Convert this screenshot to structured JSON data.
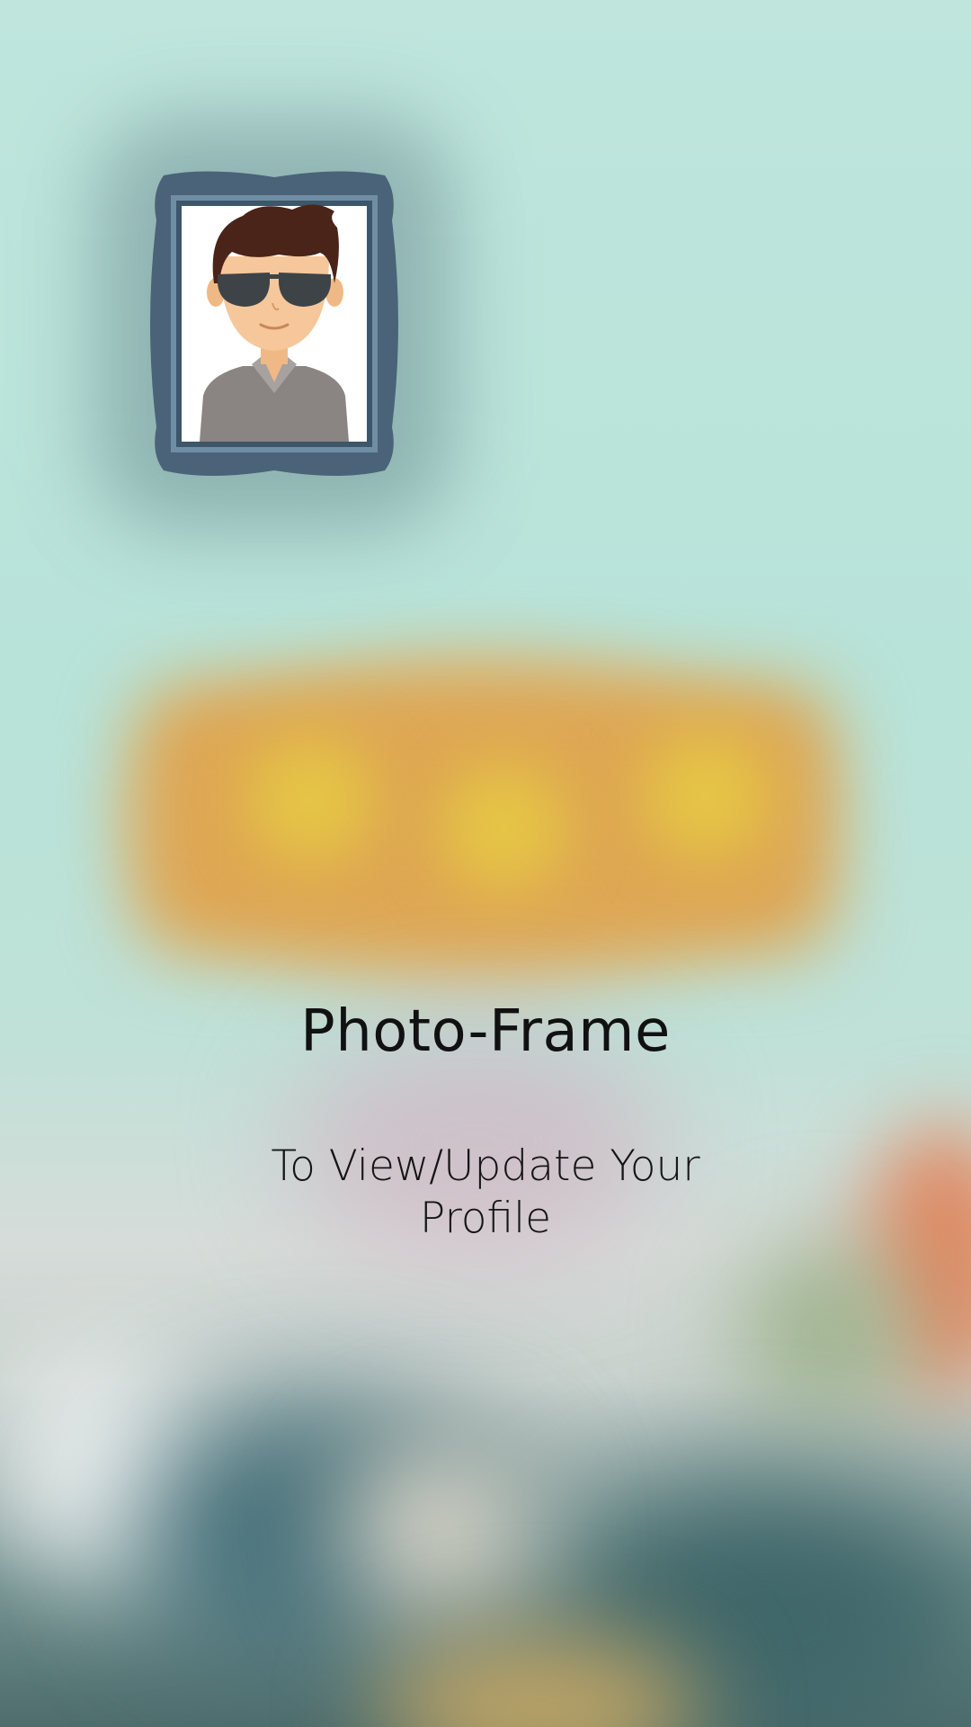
{
  "screen": {
    "title": "Photo-Frame",
    "subtitle": "To View/Update Your Profile"
  },
  "icon": {
    "name": "photo-frame-icon",
    "frame_color": "#4a6378",
    "frame_inner_color": "#6f8ea4",
    "hair_color": "#4a2418",
    "skin_color": "#f5c79a",
    "shirt_color": "#8a8482",
    "glasses_color": "#3e4347"
  },
  "colors": {
    "background_teal": "#b9e4dc",
    "glow_orange": "#dea653",
    "glow_yellow": "#e5c744",
    "text": "#111111"
  }
}
